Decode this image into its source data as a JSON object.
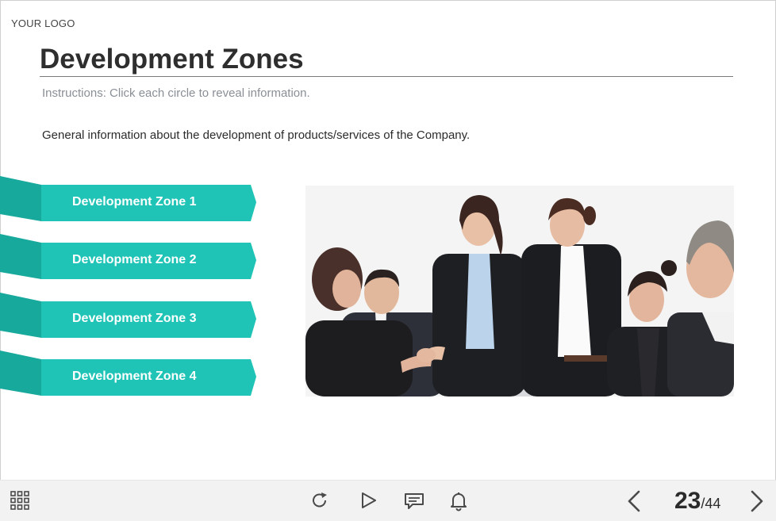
{
  "logo": "YOUR LOGO",
  "title": "Development Zones",
  "instructions": "Instructions: Click each circle to reveal information.",
  "general_info": "General information about the development of products/services of the Company.",
  "zones": [
    {
      "label": "Development Zone 1"
    },
    {
      "label": "Development Zone 2"
    },
    {
      "label": "Development Zone 3"
    },
    {
      "label": "Development Zone 4"
    }
  ],
  "colors": {
    "accent": "#1fc4b6",
    "accent_shadow": "#17a99c",
    "toolbar_bg": "#f2f2f2",
    "icon": "#4a4a4a"
  },
  "image": {
    "subject": "business-people-handshake-photo"
  },
  "toolbar": {
    "icons": [
      "grid-menu-icon",
      "replay-icon",
      "play-icon",
      "comment-icon",
      "bell-icon",
      "previous-icon",
      "next-icon"
    ],
    "page_current": "23",
    "page_total": "/44"
  }
}
